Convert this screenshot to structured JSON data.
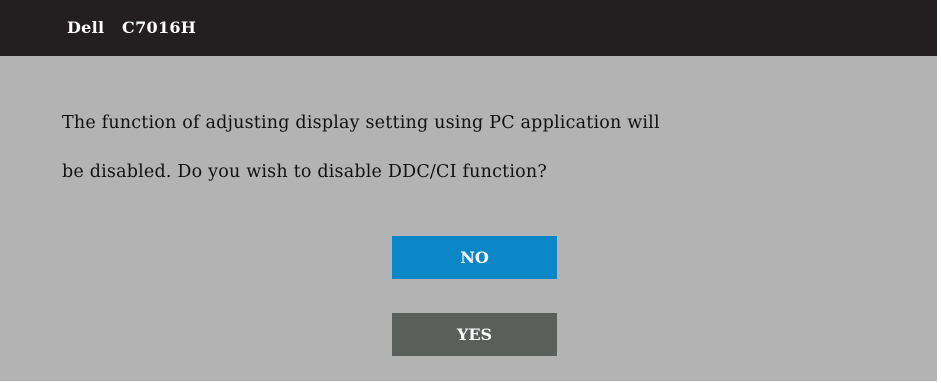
{
  "window": {
    "brand": "Dell",
    "model": "C7016H"
  },
  "dialog": {
    "message_line1": "The function of adjusting display setting using PC application will",
    "message_line2": "be disabled. Do you wish to disable DDC/CI function?"
  },
  "buttons": {
    "no_label": "NO",
    "yes_label": "YES"
  },
  "colors": {
    "title_bar": "#231f20",
    "background": "#b3b3b3",
    "no_button": "#0b87c8",
    "yes_button": "#5a5f5c"
  }
}
